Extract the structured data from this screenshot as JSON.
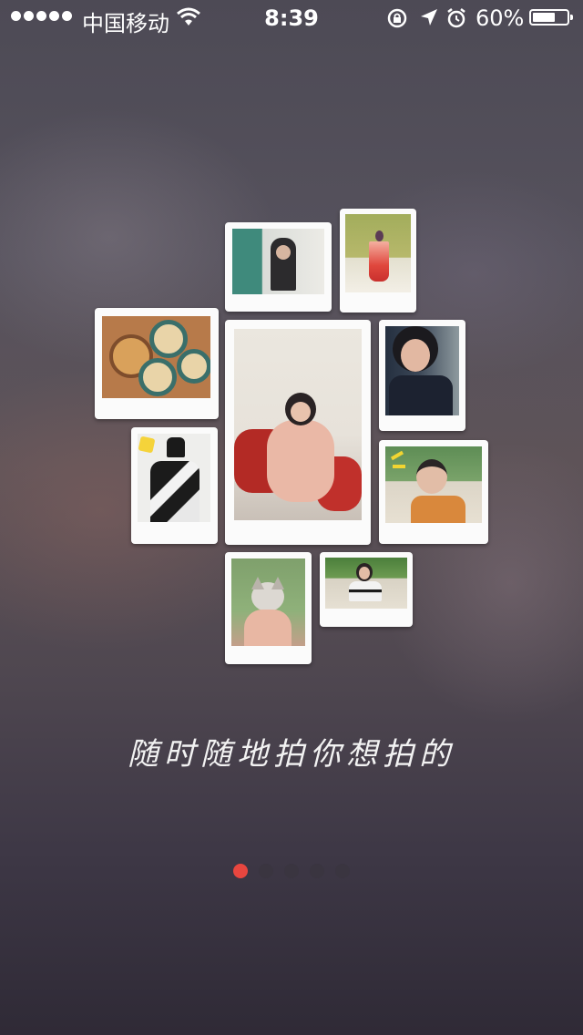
{
  "status_bar": {
    "carrier": "中国移动",
    "time": "8:39",
    "battery_percent": "60%",
    "battery_level": 0.6,
    "icons": [
      "signal-dots-icon",
      "wifi-icon",
      "rotation-lock-icon",
      "location-arrow-icon",
      "alarm-clock-icon",
      "battery-icon"
    ]
  },
  "onboarding": {
    "caption": "随时随地拍你想拍的",
    "page_count": 5,
    "current_page": 1,
    "accent_color": "#e8463f"
  },
  "photos": [
    {
      "name": "photo-girl-window"
    },
    {
      "name": "photo-red-drink"
    },
    {
      "name": "photo-coffee-cups"
    },
    {
      "name": "photo-girl-pajamas"
    },
    {
      "name": "photo-girl-car-selfie"
    },
    {
      "name": "photo-girl-black-white-jacket"
    },
    {
      "name": "photo-girl-peace-sign"
    },
    {
      "name": "photo-kitten"
    },
    {
      "name": "photo-girl-sitting-road"
    }
  ]
}
